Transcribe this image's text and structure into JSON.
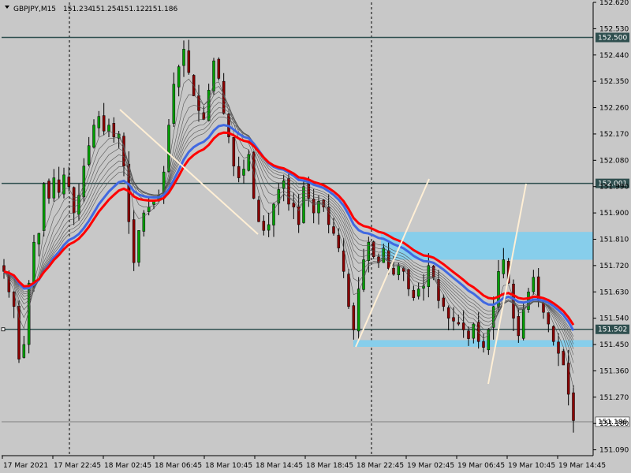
{
  "chart_data": {
    "type": "candlestick",
    "title": "GBPJPY,M15",
    "ohlc_header": [
      "151.234",
      "151.254",
      "151.122",
      "151.186"
    ],
    "current_price": 151.186,
    "ylim": [
      151.07,
      152.62
    ],
    "y_ticks": [
      "152.620",
      "152.530",
      "152.440",
      "152.350",
      "152.260",
      "152.170",
      "152.080",
      "151.990",
      "151.900",
      "151.810",
      "151.720",
      "151.630",
      "151.540",
      "151.450",
      "151.360",
      "151.270",
      "151.180",
      "151.090"
    ],
    "x_ticks": [
      "17 Mar 2021",
      "17 Mar 22:45",
      "18 Mar 02:45",
      "18 Mar 06:45",
      "18 Mar 10:45",
      "18 Mar 14:45",
      "18 Mar 18:45",
      "18 Mar 22:45",
      "19 Mar 02:45",
      "19 Mar 06:45",
      "19 Mar 10:45",
      "19 Mar 14:45"
    ],
    "levels": [
      {
        "label": "152.500",
        "value": 152.5
      },
      {
        "label": "152.001",
        "value": 152.001
      },
      {
        "label": "151.502",
        "value": 151.502
      }
    ],
    "current_label": "151.186",
    "zones": [
      {
        "from": 151.74,
        "to": 151.835
      },
      {
        "from": 151.442,
        "to": 151.465
      }
    ],
    "colors": {
      "bull": "#00a000",
      "bear": "#8b0000",
      "ema_red": "#ff0000",
      "ema_blue": "#4169e1",
      "level_line": "#2f4f4f",
      "zone": "#87ceeb",
      "trendline": "#ffefd5",
      "background": "#c8c8c8"
    },
    "closes": [
      151.7,
      151.63,
      151.58,
      151.4,
      151.45,
      151.66,
      151.8,
      151.83,
      152.0,
      151.95,
      152.02,
      151.97,
      152.03,
      151.99,
      151.9,
      151.96,
      152.06,
      152.13,
      152.2,
      152.23,
      152.18,
      152.2,
      152.16,
      152.17,
      152.06,
      151.87,
      151.73,
      151.84,
      151.9,
      151.92,
      151.94,
      151.96,
      152.04,
      152.2,
      152.34,
      152.4,
      152.46,
      152.38,
      152.3,
      152.25,
      152.22,
      152.32,
      152.42,
      152.36,
      152.24,
      152.16,
      152.06,
      152.02,
      152.05,
      152.1,
      151.95,
      151.87,
      151.84,
      151.86,
      151.93,
      151.98,
      152.01,
      151.93,
      151.92,
      151.86,
      151.99,
      151.95,
      151.9,
      151.94,
      151.92,
      151.86,
      151.83,
      151.78,
      151.7,
      151.58,
      151.5,
      151.64,
      151.74,
      151.8,
      151.75,
      151.73,
      151.78,
      151.71,
      151.69,
      151.72,
      151.7,
      151.64,
      151.61,
      151.64,
      151.65,
      151.72,
      151.68,
      151.6,
      151.58,
      151.54,
      151.53,
      151.52,
      151.5,
      151.47,
      151.52,
      151.46,
      151.44,
      151.5,
      151.58,
      151.7,
      151.74,
      151.66,
      151.54,
      151.48,
      151.57,
      151.63,
      151.68,
      151.6,
      151.56,
      151.52,
      151.46,
      151.42,
      151.38,
      151.28,
      151.19
    ]
  }
}
